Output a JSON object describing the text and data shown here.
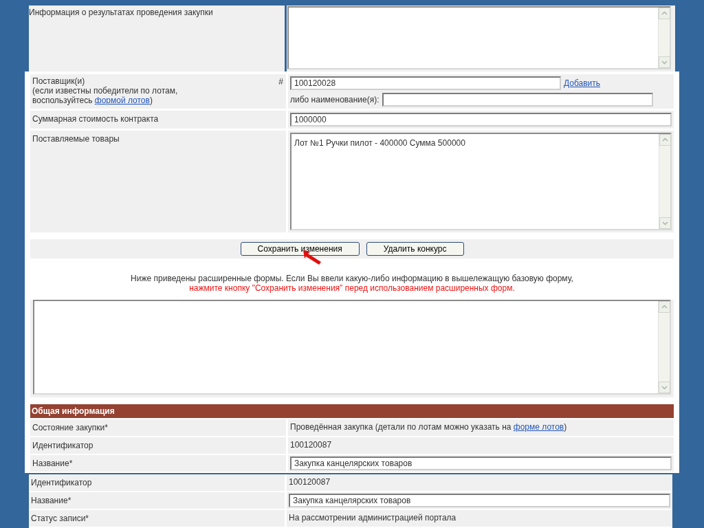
{
  "results_row": {
    "label": "Информация о результатах проведения закупки"
  },
  "supplier": {
    "label": "Поставщик(и)",
    "note_before": "(если известны победители по лотам,",
    "note_before2": "воспользуйтесь ",
    "note_link": "формой лотов",
    "note_after": ")",
    "hash": "#",
    "id_value": "100120028",
    "add_link": "Добавить",
    "name_label": "либо наименование(я):"
  },
  "sum": {
    "label": "Суммарная стоимость контракта",
    "value": "1000000"
  },
  "goods": {
    "label": "Поставляемые товары",
    "value": "Лот №1 Ручки пилот - 400000 Сумма 500000"
  },
  "buttons": [
    "Сохранить изменения",
    "Удалить конкурс"
  ],
  "notice": {
    "text": "Ниже приведены расширенные формы. Если Вы ввели какую-либо информацию в вышележащую базовую форму,",
    "warning": "нажмите кнопку \"Сохранить изменения\" перед использованием расширенных форм."
  },
  "section_title": "Общая информация",
  "general_rows": [
    {
      "kind": "link_text",
      "label": "Состояние закупки*",
      "value": "Проведённая закупка (детали по лотам можно указать на ",
      "link": "форме лотов",
      "after": ")"
    },
    {
      "kind": "text",
      "label": "Идентификатор",
      "value": "100120087"
    },
    {
      "kind": "input",
      "label": "Название*",
      "value": "Закупка канцелярских товаров"
    }
  ],
  "lower_rows": [
    {
      "kind": "text",
      "label": "Идентификатор",
      "value": "100120087"
    },
    {
      "kind": "input",
      "label": "Название*",
      "value": "Закупка канцелярских товаров"
    },
    {
      "kind": "text",
      "label": "Статус записи*",
      "value": "На рассмотрении администрацией портала"
    }
  ]
}
